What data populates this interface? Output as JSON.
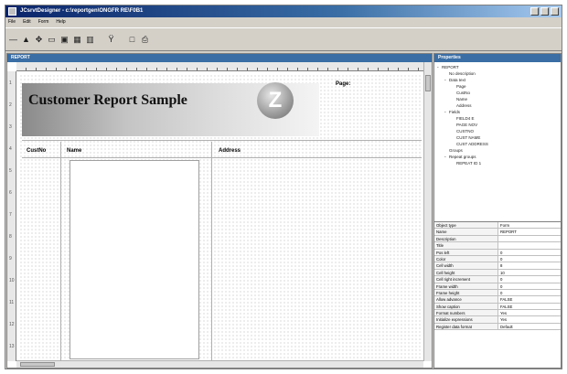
{
  "window": {
    "title": "JCsrvtDesigner - c:\\reportgen\\ONGFR RE\\F0B1"
  },
  "menubar": {
    "items": [
      "File",
      "Edit",
      "Form",
      "Help"
    ]
  },
  "toolbar": {
    "buttons": [
      "line-tool",
      "select-tool",
      "move-tool",
      "rectangle-tool",
      "image-tool",
      "table-tool",
      "barcode-tool",
      "filter-tool",
      "page-tool",
      "print-tool"
    ]
  },
  "designer": {
    "panel_title": "REPORT",
    "ruler_numbers": [
      "1",
      "2",
      "3",
      "4",
      "5",
      "6",
      "7",
      "8",
      "9",
      "10",
      "11",
      "12",
      "13"
    ],
    "report": {
      "title": "Customer Report Sample",
      "logo_letter": "Z",
      "page_label": "Page:",
      "column_headers": [
        "CustNo",
        "Name",
        "Address"
      ]
    }
  },
  "properties": {
    "panel_title": "Properties",
    "tree": [
      {
        "label": "REPORT",
        "depth": 0,
        "toggle": "-"
      },
      {
        "label": "No description",
        "depth": 1,
        "toggle": ""
      },
      {
        "label": "Data text",
        "depth": 1,
        "toggle": "-"
      },
      {
        "label": "Page",
        "depth": 2,
        "toggle": ""
      },
      {
        "label": "CustNo",
        "depth": 2,
        "toggle": ""
      },
      {
        "label": "Name",
        "depth": 2,
        "toggle": ""
      },
      {
        "label": "Address",
        "depth": 2,
        "toggle": ""
      },
      {
        "label": "Fields",
        "depth": 1,
        "toggle": "-"
      },
      {
        "label": "FIELD4 E",
        "depth": 2,
        "toggle": ""
      },
      {
        "label": "PAGE NOV",
        "depth": 2,
        "toggle": ""
      },
      {
        "label": "CUSTNO",
        "depth": 2,
        "toggle": ""
      },
      {
        "label": "CUST NAME",
        "depth": 2,
        "toggle": ""
      },
      {
        "label": "CUST ADDRESS",
        "depth": 2,
        "toggle": ""
      },
      {
        "label": "Groups",
        "depth": 1,
        "toggle": ""
      },
      {
        "label": "Repeat groups",
        "depth": 1,
        "toggle": "-"
      },
      {
        "label": "REPEAT ID 1",
        "depth": 2,
        "toggle": ""
      }
    ],
    "grid": [
      {
        "name": "Object type",
        "value": "Form"
      },
      {
        "name": "Name",
        "value": "REPORT"
      },
      {
        "name": "Description",
        "value": ""
      },
      {
        "name": "Title",
        "value": ""
      },
      {
        "name": "Pos left",
        "value": "0"
      },
      {
        "name": "Color",
        "value": "0"
      },
      {
        "name": "Cell width",
        "value": "8"
      },
      {
        "name": "Cell height",
        "value": "10"
      },
      {
        "name": "Cell right increment",
        "value": "0"
      },
      {
        "name": "Frame width",
        "value": "0"
      },
      {
        "name": "Frame height",
        "value": "0"
      },
      {
        "name": "Allow advance",
        "value": "FALSE"
      },
      {
        "name": "Show caption",
        "value": "FALSE"
      },
      {
        "name": "Format numbers",
        "value": "Yes"
      },
      {
        "name": "Initialize expressions",
        "value": "Yes"
      },
      {
        "name": "Register data format",
        "value": "Default"
      }
    ]
  }
}
